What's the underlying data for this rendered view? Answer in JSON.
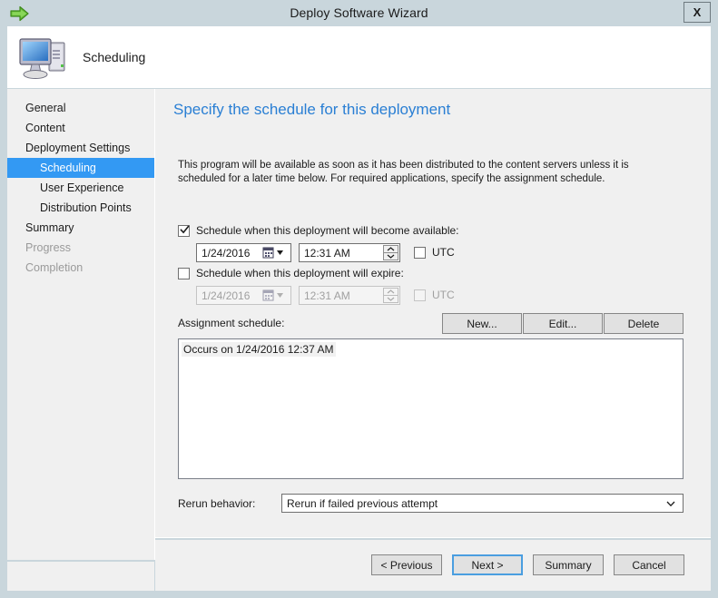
{
  "window": {
    "title": "Deploy Software Wizard",
    "close_label": "X",
    "back_icon": "green-right-arrow-icon",
    "banner_icon": "computer-icon",
    "banner_title": "Scheduling"
  },
  "sidebar": {
    "items": [
      {
        "label": "General",
        "level": 0,
        "state": "normal"
      },
      {
        "label": "Content",
        "level": 0,
        "state": "normal"
      },
      {
        "label": "Deployment Settings",
        "level": 0,
        "state": "normal"
      },
      {
        "label": "Scheduling",
        "level": 1,
        "state": "selected"
      },
      {
        "label": "User Experience",
        "level": 1,
        "state": "normal"
      },
      {
        "label": "Distribution Points",
        "level": 1,
        "state": "normal"
      },
      {
        "label": "Summary",
        "level": 0,
        "state": "normal"
      },
      {
        "label": "Progress",
        "level": 0,
        "state": "disabled"
      },
      {
        "label": "Completion",
        "level": 0,
        "state": "disabled"
      }
    ],
    "selected_color": "#3399f3"
  },
  "content": {
    "heading": "Specify the schedule for this deployment",
    "intro": "This program will be available as soon as it has been distributed to the content servers unless it is scheduled for a later time below. For required applications, specify the assignment schedule.",
    "available": {
      "checkbox_label": "Schedule when this deployment will become available:",
      "checked": true,
      "date": "1/24/2016",
      "time": "12:31 AM",
      "utc_label": "UTC",
      "utc_checked": false
    },
    "expire": {
      "checkbox_label": "Schedule when this deployment will expire:",
      "checked": false,
      "date": "1/24/2016",
      "time": "12:31 AM",
      "utc_label": "UTC",
      "utc_checked": false,
      "disabled": true
    },
    "assignment": {
      "label": "Assignment schedule:",
      "new_label": "New...",
      "edit_label": "Edit...",
      "delete_label": "Delete",
      "entries": [
        "Occurs on 1/24/2016 12:37 AM"
      ]
    },
    "rerun": {
      "label": "Rerun behavior:",
      "value": "Rerun if failed previous attempt"
    }
  },
  "footer": {
    "previous_label": "< Previous",
    "next_label": "Next >",
    "summary_label": "Summary",
    "cancel_label": "Cancel"
  }
}
